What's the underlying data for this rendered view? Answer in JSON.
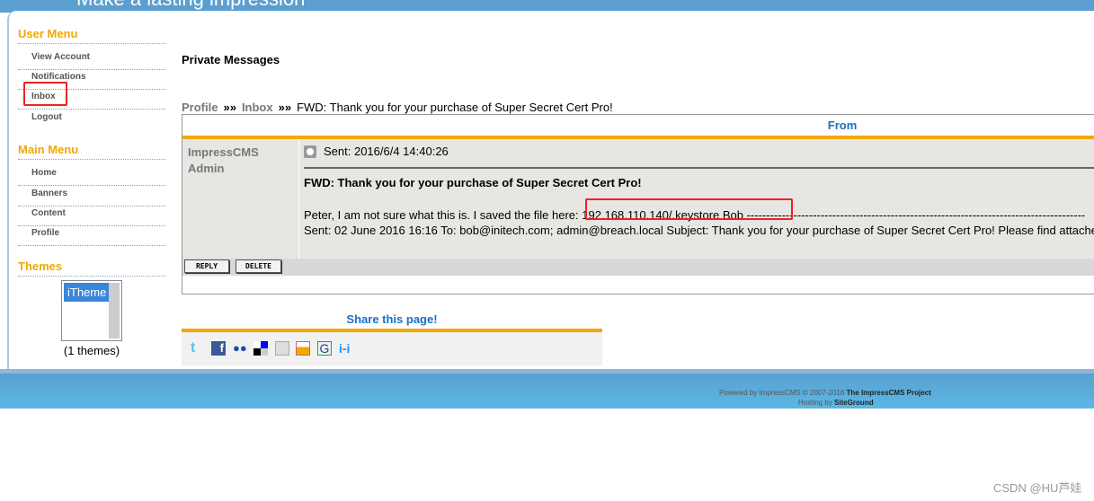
{
  "header": {
    "tagline": "Make a lasting impression"
  },
  "sidebar": {
    "user_menu": {
      "title": "User Menu",
      "items": [
        "View Account",
        "Notifications",
        "Inbox",
        "Logout"
      ]
    },
    "main_menu": {
      "title": "Main Menu",
      "items": [
        "Home",
        "Banners",
        "Content",
        "Profile"
      ]
    },
    "themes": {
      "title": "Themes",
      "selected": "iTheme",
      "count": "(1 themes)"
    }
  },
  "main": {
    "title": "Private Messages",
    "breadcrumb": {
      "profile": "Profile",
      "sep": "»»",
      "inbox": "Inbox",
      "current": "FWD: Thank you for your purchase of Super Secret Cert Pro!"
    },
    "message": {
      "from_header": "From",
      "sender": "ImpressCMS Admin",
      "sent": "Sent: 2016/6/4 14:40:26",
      "subject": "FWD: Thank you for your purchase of Super Secret Cert Pro!",
      "line1": "Peter, I am not sure what this is. I saved the file here: 192.168.110.140/.keystore Bob ---------------------------------------------------------------------------------------",
      "line2": "Sent: 02 June 2016 16:16 To: bob@initech.com; admin@breach.local Subject: Thank you for your purchase of Super Secret Cert Pro! Please find attached",
      "reply": "REPLY",
      "delete": "DELETE"
    },
    "share": {
      "title": "Share this page!",
      "icons": [
        "twitter-icon",
        "facebook-icon",
        "myspace-icon",
        "delicious-icon",
        "digg-icon",
        "stumble-icon",
        "google-icon",
        "hi5-icon"
      ]
    }
  },
  "footer": {
    "powered": "Powered by ImpressCMS © 2007-2016 ",
    "project": "The ImpressCMS Project",
    "hosting": "Hosting by ",
    "host": "SiteGround"
  },
  "watermark": "CSDN @HU芦娃",
  "colors": {
    "accent": "#f0a800",
    "link": "#1a6fc6",
    "footer": "#5ab0dc"
  }
}
